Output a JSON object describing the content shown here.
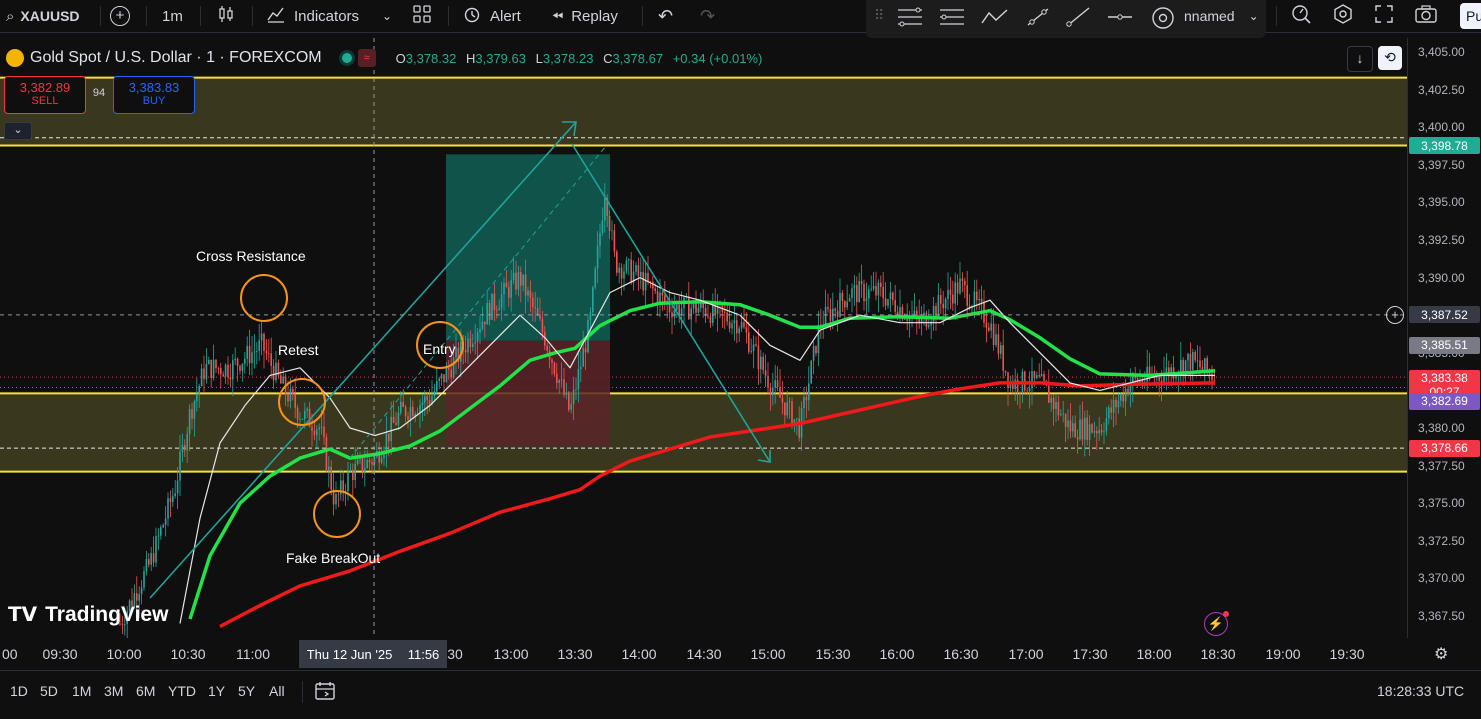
{
  "topbar": {
    "symbol": "XAUUSD",
    "interval": "1m",
    "indicators": "Indicators",
    "alert": "Alert",
    "replay": "Replay",
    "layout_name": "nnamed",
    "publish": "Pu"
  },
  "legend": {
    "title": "Gold Spot / U.S. Dollar · 1 · FOREXCOM",
    "o_label": "O",
    "o_value": "3,378.32",
    "h_label": "H",
    "h_value": "3,379.63",
    "l_label": "L",
    "l_value": "3,378.23",
    "c_label": "C",
    "c_value": "3,378.67",
    "change": "+0.34 (+0.01%)"
  },
  "trade": {
    "sell_price": "3,382.89",
    "sell_label": "SELL",
    "spread": "94",
    "buy_price": "3,383.83",
    "buy_label": "BUY"
  },
  "price_axis": {
    "labels": [
      "3,405.00",
      "3,402.50",
      "3,400.00",
      "3,397.50",
      "3,395.00",
      "3,392.50",
      "3,390.00",
      "3,387.50",
      "3,385.00",
      "3,382.50",
      "3,380.00",
      "3,377.50",
      "3,375.00",
      "3,372.50",
      "3,370.00",
      "3,367.50"
    ],
    "tags": {
      "zone_top": "3,398.78",
      "crosshair": "3,387.52",
      "ma_gray": "3,385.51",
      "last_price": "3,383.38",
      "countdown": "00:27",
      "ma_purple": "3,382.69",
      "zone_bottom": "3,378.66"
    }
  },
  "time_axis": {
    "labels": [
      "00",
      "09:30",
      "10:00",
      "10:30",
      "11:00",
      "30",
      "13:00",
      "13:30",
      "14:00",
      "14:30",
      "15:00",
      "15:30",
      "16:00",
      "16:30",
      "17:00",
      "17:30",
      "18:00",
      "18:30",
      "19:00",
      "19:30"
    ],
    "crosshair_date": "Thu 12 Jun '25",
    "crosshair_time": "11:56"
  },
  "annotations": {
    "cross_resistance": "Cross Resistance",
    "retest": "Retest",
    "entry": "Entry",
    "fake_breakout": "Fake BreakOut"
  },
  "watermark": "TradingView",
  "bottombar": {
    "ranges": [
      "1D",
      "5D",
      "1M",
      "3M",
      "6M",
      "YTD",
      "1Y",
      "5Y",
      "All"
    ],
    "clock": "18:28:33 UTC"
  },
  "colors": {
    "bg": "#0f0f0f",
    "zone_line": "#f5e13b",
    "zone_fill": "#4a4526",
    "green_ma": "#22e24a",
    "red_ma": "#f01a1a",
    "white_ma": "#e8e8e8",
    "long_target": "#0f5f55",
    "long_stop": "#5b2428",
    "teal_line": "#1fa39a",
    "circle": "#f7931a",
    "up_candle": "#26a69a",
    "down_candle": "#ef5350"
  }
}
